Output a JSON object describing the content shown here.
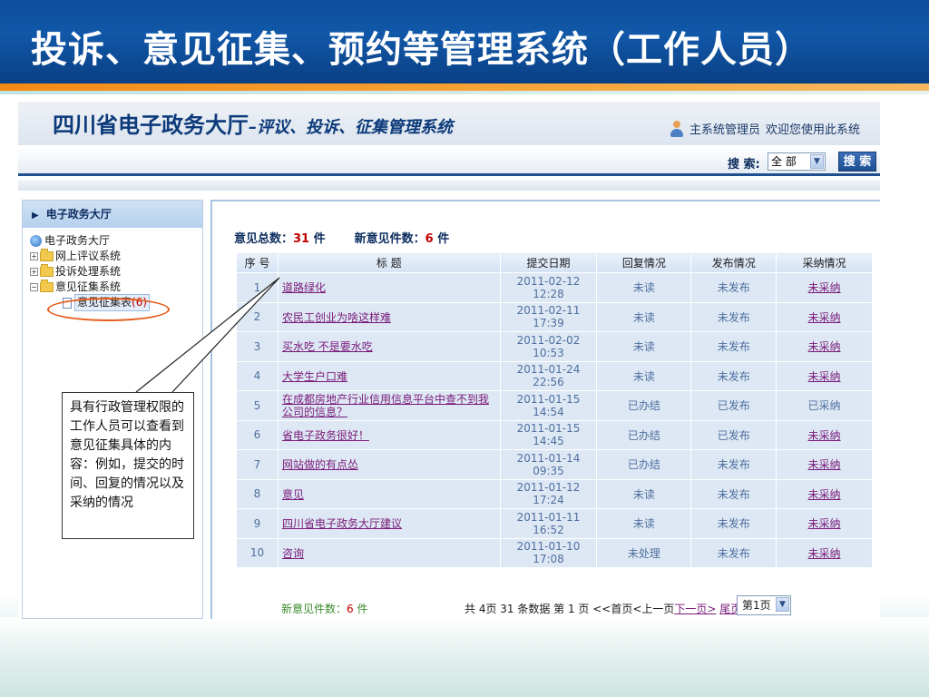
{
  "slide": {
    "title": "投诉、意见征集、预约等管理系统（工作人员）"
  },
  "app": {
    "title_main": "四川省电子政务大厅",
    "title_sub": "–评议、投诉、征集管理系统",
    "user_role": "主系统管理员",
    "welcome": "欢迎您使用此系统",
    "search": {
      "label": "搜 索:",
      "selected": "全 部",
      "button": "搜 索"
    }
  },
  "sidebar": {
    "header": "电子政务大厅",
    "root": "电子政务大厅",
    "items": [
      {
        "label": "网上评议系统"
      },
      {
        "label": "投诉处理系统"
      },
      {
        "label": "意见征集系统"
      }
    ],
    "child": {
      "label": "意见征集表",
      "count": "(6)"
    }
  },
  "stats": {
    "total_label": "意见总数：",
    "total_value": "31",
    "total_unit": "件",
    "new_label": "新意见件数：",
    "new_value": "6",
    "new_unit": "件"
  },
  "table": {
    "headers": [
      "序 号",
      "标 题",
      "提交日期",
      "回复情况",
      "发布情况",
      "采纳情况"
    ],
    "rows": [
      {
        "no": "1",
        "title": "道路绿化",
        "date": "2011-02-12 12:28",
        "reply": "未读",
        "publish": "未发布",
        "adopt": "未采纳"
      },
      {
        "no": "2",
        "title": "农民工创业为啥这样难",
        "date": "2011-02-11 17:39",
        "reply": "未读",
        "publish": "未发布",
        "adopt": "未采纳"
      },
      {
        "no": "3",
        "title": "买水吃 不是要水吃",
        "date": "2011-02-02 10:53",
        "reply": "未读",
        "publish": "未发布",
        "adopt": "未采纳"
      },
      {
        "no": "4",
        "title": "大学生户口难",
        "date": "2011-01-24 22:56",
        "reply": "未读",
        "publish": "未发布",
        "adopt": "未采纳"
      },
      {
        "no": "5",
        "title": "在成都房地产行业信用信息平台中查不到我公司的信息？",
        "date": "2011-01-15 14:54",
        "reply": "已办结",
        "publish": "已发布",
        "adopt": "已采纳"
      },
      {
        "no": "6",
        "title": "省电子政务很好！",
        "date": "2011-01-15 14:45",
        "reply": "已办结",
        "publish": "已发布",
        "adopt": "未采纳"
      },
      {
        "no": "7",
        "title": "网站做的有点怂",
        "date": "2011-01-14 09:35",
        "reply": "已办结",
        "publish": "未发布",
        "adopt": "未采纳"
      },
      {
        "no": "8",
        "title": "意见",
        "date": "2011-01-12 17:24",
        "reply": "未读",
        "publish": "未发布",
        "adopt": "未采纳"
      },
      {
        "no": "9",
        "title": "四川省电子政务大厅建议",
        "date": "2011-01-11 16:52",
        "reply": "未读",
        "publish": "未发布",
        "adopt": "未采纳"
      },
      {
        "no": "10",
        "title": "咨询",
        "date": "2011-01-10 17:08",
        "reply": "未处理",
        "publish": "未发布",
        "adopt": "未采纳"
      }
    ]
  },
  "footer": {
    "new_label": "新意见件数：",
    "new_value": "6",
    "new_unit": "件",
    "pager_info": "共 4页 31 条数据  第 1 页 <<首页<上一页",
    "next": "下一页>",
    "last": "尾页>>",
    "page_selected": "第1页"
  },
  "callout": {
    "text": "具有行政管理权限的工作人员可以查看到意见征集具体的内容：例如，提交的时间、回复的情况以及采纳的情况"
  },
  "colors": {
    "header_blue": "#0d4f9c",
    "accent_orange": "#f58a14",
    "highlight_red": "#c00000",
    "link_purple": "#7a1a7a"
  }
}
